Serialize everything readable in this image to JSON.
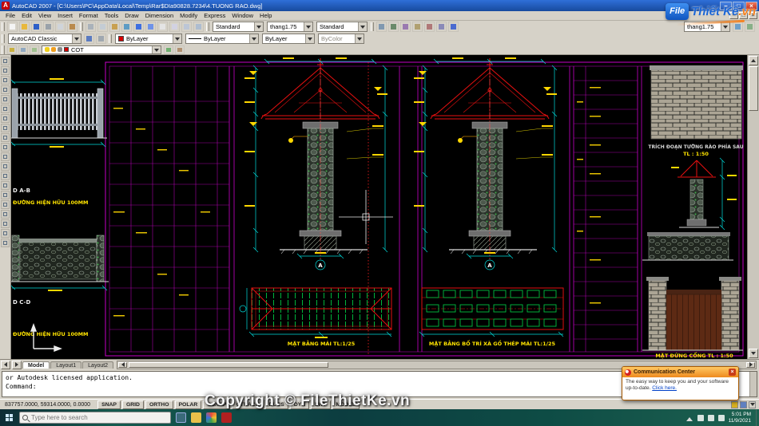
{
  "window": {
    "title": "AutoCAD 2007 - [C:\\Users\\PC\\AppData\\Local\\Temp\\Rar$DIa90828.7234\\4.TUONG RAO.dwg]"
  },
  "icons": {
    "app": "A",
    "minimize": "–",
    "maximize": "□",
    "close": "×"
  },
  "menu": {
    "items": [
      "File",
      "Edit",
      "View",
      "Insert",
      "Format",
      "Tools",
      "Draw",
      "Dimension",
      "Modify",
      "Express",
      "Window",
      "Help"
    ]
  },
  "toolbars": {
    "text_style": "Standard",
    "dim_style": "thang1.75",
    "table_style": "Standard",
    "dim_style_right": "thang1.75",
    "workspace": "AutoCAD Classic",
    "color": "ByLayer",
    "linetype": "ByLayer",
    "lineweight": "ByLayer",
    "plot_style": "ByColor",
    "layer": "COT"
  },
  "canvas": {
    "grid_a": "A",
    "labels": {
      "section_ab": "D A-B",
      "road_ab": "ĐƯỜNG HIỆN HỮU 100MM",
      "section_cd": "D C-D",
      "road_cd": "ĐƯỜNG HIỆN HỮU 100MM",
      "plan_roof": "MẶT BẰNG MÁI TL:1/25",
      "plan_purlin": "MẶT BẰNG BỐ TRÍ XÀ GỒ THÉP MÁI TL:1/25",
      "rear_wall_1": "TRÍCH ĐOẠN TƯỜNG RÀO PHÍA SAU",
      "rear_wall_2": "TL : 1:50",
      "gate": "MẶT ĐỨNG CỔNG TL : 1:50"
    }
  },
  "tabs": {
    "items": [
      "Model",
      "Layout1",
      "Layout2"
    ]
  },
  "command": {
    "line1": "or Autodesk licensed application.",
    "line2": "Command:"
  },
  "status": {
    "coords": "837757.0000, 59314.0000, 0.0000",
    "buttons": [
      "SNAP",
      "GRID",
      "ORTHO",
      "POLAR",
      "OSNAP",
      "OTRACK",
      "DUCS",
      "DYN",
      "LWT",
      "MODEL"
    ]
  },
  "comm": {
    "title": "Communication Center",
    "body": "The easy way to keep you and your software up-to-date.",
    "link": "Click here."
  },
  "taskbar": {
    "search_placeholder": "Type here to search",
    "time": "5:01 PM",
    "date": "11/9/2021"
  },
  "watermark": {
    "text": "Copyright © FileThietKe.vn"
  },
  "logo": {
    "box": "File",
    "name": "Thiết Kế",
    "tld": ".vn"
  }
}
